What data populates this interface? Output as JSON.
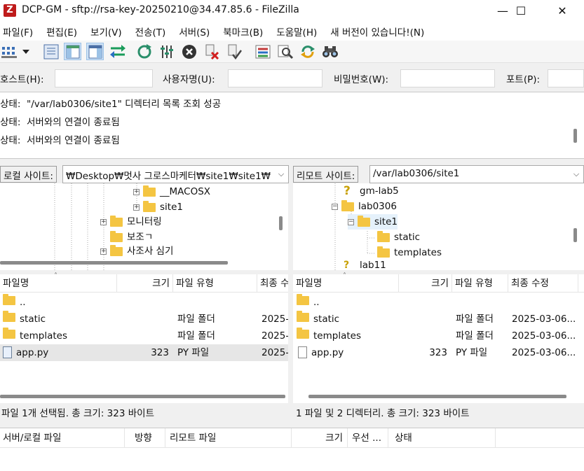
{
  "window": {
    "title": "DCP-GM - sftp://rsa-key-20250210@34.47.85.6 - FileZilla",
    "icon_letter": "Z",
    "min": "—",
    "max": "☐",
    "close": "✕"
  },
  "menu": [
    "파일(F)",
    "편집(E)",
    "보기(V)",
    "전송(T)",
    "서버(S)",
    "북마크(B)",
    "도움말(H)",
    "새 버전이 있습니다!(N)"
  ],
  "quickconnect": {
    "host_label": "호스트(H):",
    "user_label": "사용자명(U):",
    "pass_label": "비밀번호(W):",
    "port_label": "포트(P):",
    "host_value": "",
    "user_value": "",
    "pass_value": "",
    "port_value": ""
  },
  "log": [
    {
      "label": "상태:",
      "text": "\"/var/lab0306/site1\" 디렉터리 목록 조회 성공"
    },
    {
      "label": "상태:",
      "text": "서버와의 연결이 종료됨"
    },
    {
      "label": "상태:",
      "text": "서버와의 연결이 종료됨"
    }
  ],
  "local": {
    "site_label": "로컬 사이트:",
    "path": "₩Desktop₩멋사 그로스마케터₩site1₩site1₩",
    "tree": [
      {
        "name": "__MACOSX",
        "expander": "+"
      },
      {
        "name": "site1",
        "expander": "+"
      },
      {
        "name": "모니터링",
        "expander": "+"
      },
      {
        "name": "보조ㄱ",
        "expander": ""
      },
      {
        "name": "사조사 심기",
        "expander": "+"
      }
    ],
    "columns": [
      "파일명",
      "크기",
      "파일 유형",
      "최종 수"
    ],
    "files": [
      {
        "name": "..",
        "size": "",
        "type": "",
        "modified": ""
      },
      {
        "name": "static",
        "size": "",
        "type": "파일 폴더",
        "modified": "2025-"
      },
      {
        "name": "templates",
        "size": "",
        "type": "파일 폴더",
        "modified": "2025-"
      },
      {
        "name": "app.py",
        "size": "323",
        "type": "PY 파일",
        "modified": "2025-"
      }
    ],
    "status": "파일 1개 선택됨. 총 크기: 323 바이트"
  },
  "remote": {
    "site_label": "리모트 사이트:",
    "path": "/var/lab0306/site1",
    "tree": [
      {
        "name": "gm-lab5",
        "kind": "unknown"
      },
      {
        "name": "lab0306",
        "expander": "−"
      },
      {
        "name": "site1",
        "expander": "−"
      },
      {
        "name": "static",
        "expander": ""
      },
      {
        "name": "templates",
        "expander": ""
      },
      {
        "name": "lab11",
        "kind": "unknown"
      }
    ],
    "columns": [
      "파일명",
      "크기",
      "파일 유형",
      "최종 수정"
    ],
    "files": [
      {
        "name": "..",
        "size": "",
        "type": "",
        "modified": ""
      },
      {
        "name": "static",
        "size": "",
        "type": "파일 폴더",
        "modified": "2025-03-06..."
      },
      {
        "name": "templates",
        "size": "",
        "type": "파일 폴더",
        "modified": "2025-03-06..."
      },
      {
        "name": "app.py",
        "size": "323",
        "type": "PY 파일",
        "modified": "2025-03-06..."
      }
    ],
    "status": "1 파일 및 2 디렉터리. 총 크기: 323 바이트"
  },
  "queue": {
    "columns": [
      "서버/로컬 파일",
      "방향",
      "리모트 파일",
      "크기",
      "우선 ...",
      "상태"
    ]
  }
}
